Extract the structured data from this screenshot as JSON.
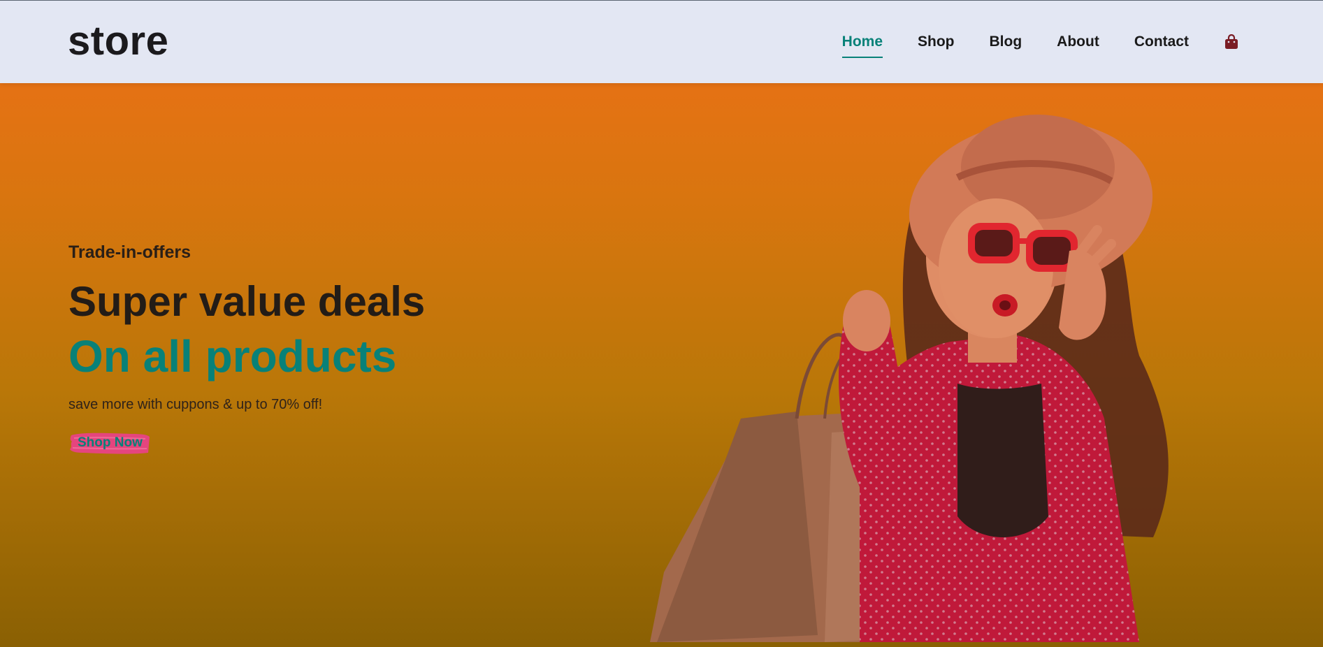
{
  "brand": {
    "logo": "store"
  },
  "nav": {
    "items": [
      {
        "label": "Home",
        "active": true
      },
      {
        "label": "Shop",
        "active": false
      },
      {
        "label": "Blog",
        "active": false
      },
      {
        "label": "About",
        "active": false
      },
      {
        "label": "Contact",
        "active": false
      }
    ],
    "cart_icon": "shopping-bag-icon"
  },
  "hero": {
    "tag": "Trade-in-offers",
    "title": "Super value deals",
    "accent": "On all products",
    "subtitle": "save more with cuppons & up to 70% off!",
    "cta_label": "Shop Now",
    "image": "woman-with-shopping-bags"
  },
  "colors": {
    "header_bg": "#e3e7f3",
    "accent": "#088178",
    "hero_top": "#e57214",
    "hero_bottom": "#8a6003",
    "cta_brush": "#e5457e",
    "cart_icon": "#7a1c24"
  }
}
